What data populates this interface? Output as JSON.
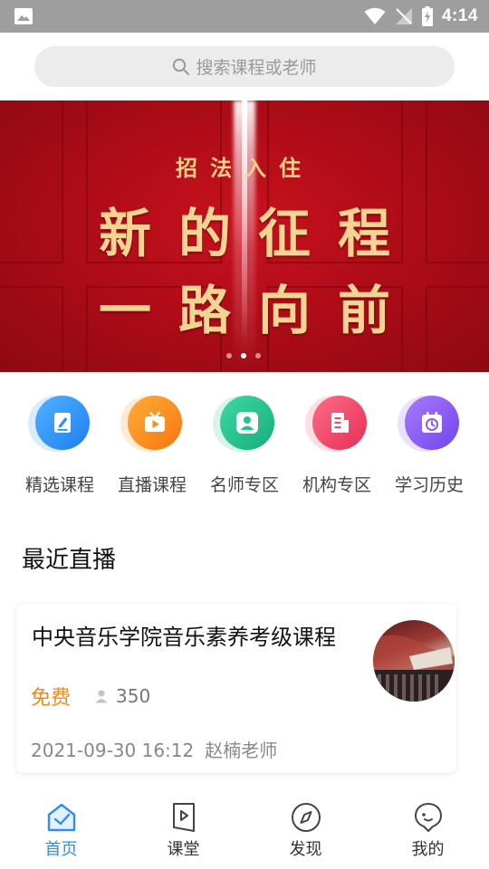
{
  "status_bar": {
    "time": "4:14"
  },
  "search": {
    "placeholder": "搜索课程或老师"
  },
  "banner": {
    "small_title": "招法入住",
    "line1": "新的征程",
    "line2": "一路向前",
    "slide_count": 3,
    "active_slide": 2
  },
  "categories": [
    {
      "label": "精选课程",
      "icon": "edit-icon",
      "color": "#2f8ef6"
    },
    {
      "label": "直播课程",
      "icon": "tv-icon",
      "color": "#fb8a16"
    },
    {
      "label": "名师专区",
      "icon": "users-icon",
      "color": "#23c28e"
    },
    {
      "label": "机构专区",
      "icon": "building-icon",
      "color": "#f0476a"
    },
    {
      "label": "学习历史",
      "icon": "calendar-clock-icon",
      "color": "#8a5cf2"
    }
  ],
  "section": {
    "title": "最近直播"
  },
  "live": {
    "title": "中央音乐学院音乐素养考级课程",
    "price": "免费",
    "views": "350",
    "datetime": "2021-09-30 16:12",
    "teacher": "赵楠老师"
  },
  "nav": {
    "items": [
      {
        "label": "首页",
        "icon": "home-icon",
        "active": true
      },
      {
        "label": "课堂",
        "icon": "play-book-icon",
        "active": false
      },
      {
        "label": "发现",
        "icon": "compass-icon",
        "active": false
      },
      {
        "label": "我的",
        "icon": "profile-icon",
        "active": false
      }
    ],
    "active_color": "#2f8cf0"
  }
}
